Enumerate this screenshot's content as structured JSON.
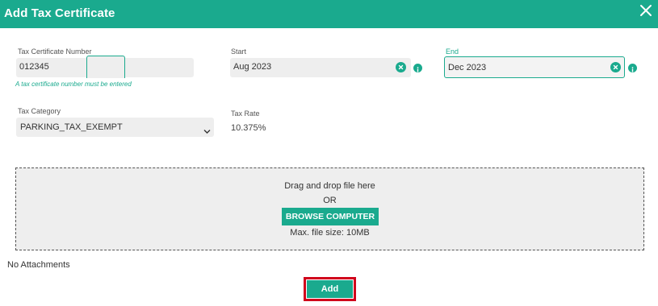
{
  "dialog": {
    "title": "Add Tax Certificate",
    "close_icon": "close-icon"
  },
  "form": {
    "tax_certificate_number": {
      "label": "Tax Certificate Number",
      "value": "012345",
      "validation_message": "A tax certificate number must be entered"
    },
    "start": {
      "label": "Start",
      "value": "Aug 2023",
      "clear_icon": "clear-icon",
      "info_icon": "info-icon"
    },
    "end": {
      "label": "End",
      "value": "Dec 2023",
      "clear_icon": "clear-icon",
      "info_icon": "info-icon"
    },
    "tax_category": {
      "label": "Tax Category",
      "selected": "PARKING_TAX_EXEMPT",
      "chevron_icon": "chevron-down-icon"
    },
    "tax_rate": {
      "label": "Tax Rate",
      "value": "10.375%"
    }
  },
  "upload": {
    "instruction": "Drag and drop file here",
    "or_text": "OR",
    "browse_label": "BROWSE COMPUTER",
    "max_size": "Max. file size: 10MB"
  },
  "attachments": {
    "empty_text": "No Attachments"
  },
  "actions": {
    "add_label": "Add"
  },
  "colors": {
    "accent": "#1aaa8e",
    "highlight": "#d0021b",
    "field_bg": "#eeeeee"
  }
}
